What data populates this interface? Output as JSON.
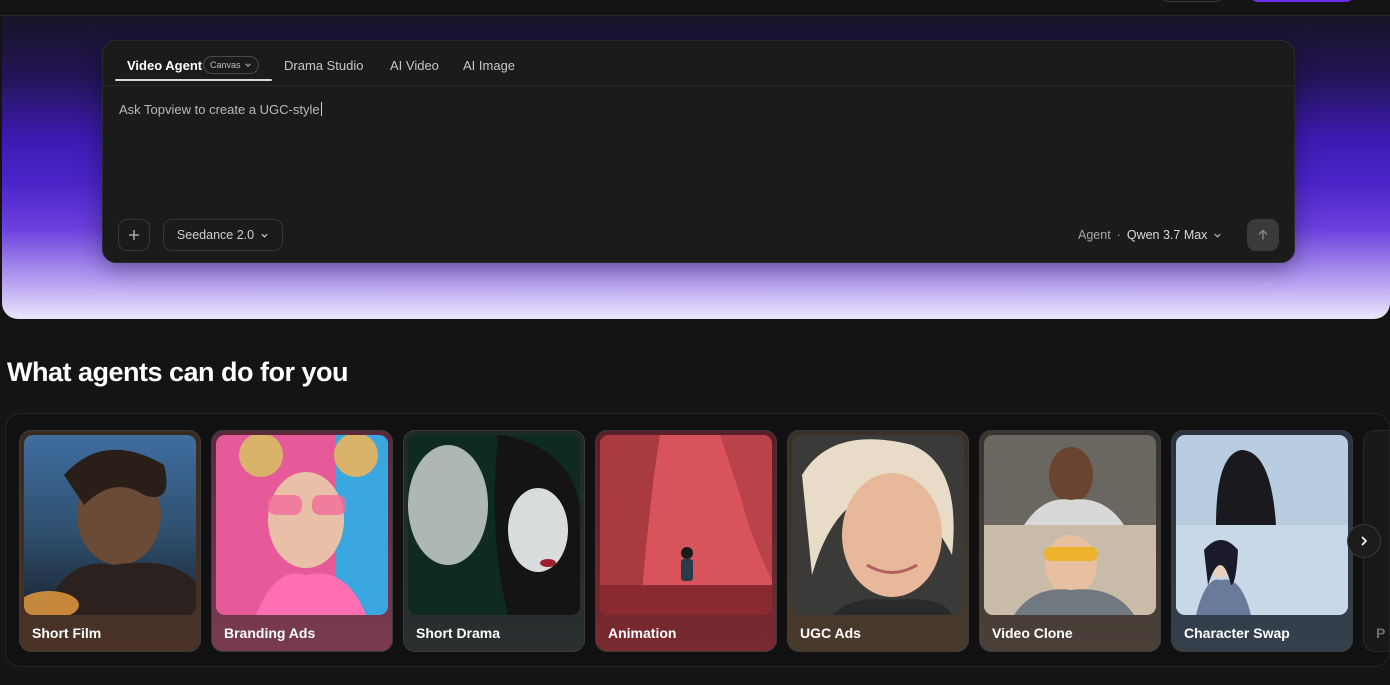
{
  "composer": {
    "tabs": [
      {
        "label": "Video Agent",
        "badge": "Canvas"
      },
      {
        "label": "Drama Studio"
      },
      {
        "label": "AI Video"
      },
      {
        "label": "AI Image"
      }
    ],
    "prompt_text": "Ask Topview to create a UGC-style",
    "model_label": "Seedance 2.0",
    "agent_label": "Agent",
    "agent_model": "Qwen 3.7 Max"
  },
  "section": {
    "title": "What agents can do for you",
    "cards": [
      {
        "label": "Short Film"
      },
      {
        "label": "Branding Ads"
      },
      {
        "label": "Short Drama"
      },
      {
        "label": "Animation"
      },
      {
        "label": "UGC Ads"
      },
      {
        "label": "Video Clone"
      },
      {
        "label": "Character Swap"
      }
    ],
    "partial_card_label": "P"
  },
  "icons": {
    "plus": "plus-icon",
    "chevron": "chevron-down-icon",
    "send": "arrow-up-icon",
    "next": "chevron-right-icon"
  },
  "colors": {
    "accent": "#6a2df0",
    "background": "#141414"
  }
}
